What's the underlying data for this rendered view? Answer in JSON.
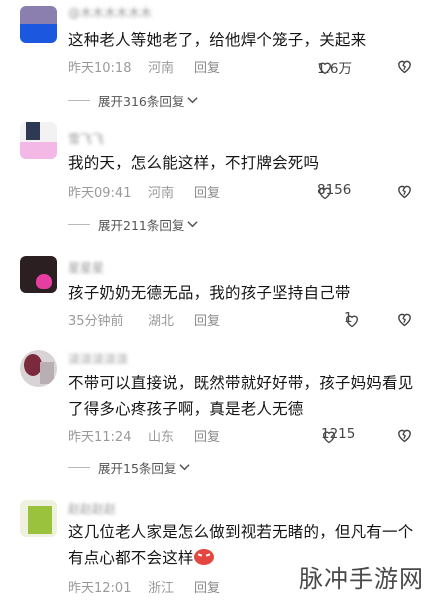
{
  "comments": [
    {
      "username": "@木木木木木木",
      "text": "这种老人等她老了，给他焊个笼子，关起来",
      "time": "昨天10:18",
      "location": "河南",
      "reply": "回复",
      "likes": "1.6万",
      "expand": "展开316条回复"
    },
    {
      "username": "雪飞飞",
      "text": "我的天，怎么能这样，不打牌会死吗",
      "time": "昨天09:41",
      "location": "河南",
      "reply": "回复",
      "likes": "8156",
      "expand": "展开211条回复"
    },
    {
      "username": "星星星",
      "text": "孩子奶奶无德无品，我的孩子坚持自己带",
      "time": "35分钟前",
      "location": "湖北",
      "reply": "回复",
      "likes": "1"
    },
    {
      "username": "淡淡淡淡淡",
      "text": "不带可以直接说，既然带就好好带，孩子妈妈看见了得多心疼孩子啊，真是老人无德",
      "time": "昨天11:24",
      "location": "山东",
      "reply": "回复",
      "likes": "1215",
      "expand": "展开15条回复"
    },
    {
      "username": "赵赵赵赵",
      "text": "这几位老人家是怎么做到视若无睹的，但凡有一个有点心都不会这样",
      "time": "昨天12:01",
      "location": "浙江",
      "reply": "回复"
    }
  ],
  "icons": {
    "like": "heart-outline-icon",
    "dislike": "broken-heart-outline-icon",
    "expand": "chevron-down-icon",
    "emoji": "angry-face-emoji-icon"
  },
  "watermark": "脉冲手游网"
}
